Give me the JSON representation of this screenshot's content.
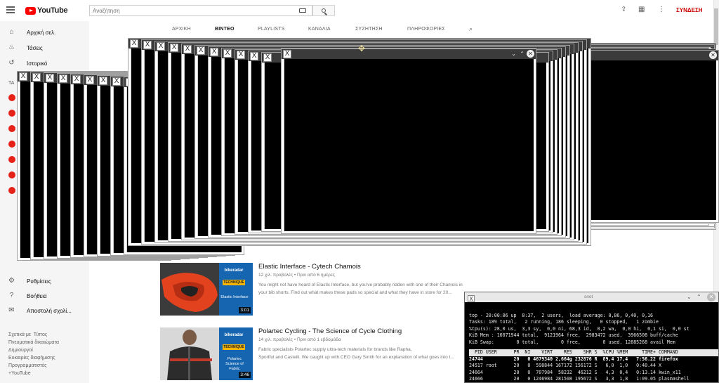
{
  "youtube": {
    "logo_text": "YouTube",
    "search": {
      "placeholder": "Αναζήτηση"
    },
    "signin_label": "ΣΥΝΔΕΣΗ",
    "sidebar": {
      "items": [
        {
          "label": "Αρχική σελ.",
          "icon": "home-icon"
        },
        {
          "label": "Τάσεις",
          "icon": "fire-icon"
        },
        {
          "label": "Ιστορικό",
          "icon": "history-icon"
        }
      ],
      "section_letters": "ΤΑ",
      "bottom_items": [
        {
          "label": "Ρυθμίσεις",
          "icon": "gear-icon"
        },
        {
          "label": "Βοήθεια",
          "icon": "help-icon"
        },
        {
          "label": "Αποστολή σχολί...",
          "icon": "feedback-icon"
        }
      ],
      "footer_links": [
        "Σχετικά με",
        "Τύπος",
        "Πνευματικά δικαιώματα",
        "Δημιουργοί",
        "Ευκαιρίες διαφήμισης",
        "Προγραμματιστές",
        "+YouTube"
      ]
    },
    "channel_tabs": [
      {
        "label": "ΑΡΧΙΚΗ",
        "active": false
      },
      {
        "label": "ΒΙΝΤΕΟ",
        "active": true
      },
      {
        "label": "PLAYLISTS",
        "active": false
      },
      {
        "label": "ΚΑΝΑΛΙΑ",
        "active": false
      },
      {
        "label": "ΣΥΖΗΤΗΣΗ",
        "active": false
      },
      {
        "label": "ΠΛΗΡΟΦΟΡΙΕΣ",
        "active": false
      }
    ],
    "videos": [
      {
        "title": "Elastic Interface - Cytech Chamois",
        "meta": "12 χιλ. προβολές • Πριν από 6 ημέρες",
        "desc_1": "You might not have heard of Elastic Interface, but you've probably ridden with one of their Chamois in",
        "desc_2": "your bib shorts. Find out what makes these pads so special and what they have in store for 20...",
        "badge": "bikeradar",
        "badge_sub": "TECHNIQUE",
        "panel_text": "Elastic Interface",
        "duration": "3:01"
      },
      {
        "title": "Polartec Cycling - The Science of Cycle Clothing",
        "meta": "14 χιλ. προβολές • Πριν από 1 εβδομάδα",
        "desc_1": "Fabric specialists Polartec supply ultra-tech materials for brands like Rapha,",
        "desc_2": "Sportful and Castelli. We caught up with CEO Gary Smith for an explanation of what goes into t...",
        "badge": "bikeradar",
        "badge_sub": "TECHNIQUE",
        "panel_text": "Polartec Science of Fabric",
        "duration": "3:46"
      }
    ]
  },
  "xwindow": {
    "title_glyph": "X",
    "close_glyph": "✕",
    "min_glyph": "⌄",
    "max_glyph": "⌃"
  },
  "terminal": {
    "title": "snot",
    "lines": {
      "l1": "top - 20:00:06 up  8:37,  2 users,  load average: 0,86, 0,40, 0,16",
      "l2": "Tasks: 189 total,   2 running, 186 sleeping,   0 stopped,   1 zombie",
      "l3": "%Cpu(s): 28,0 us,  3,3 sy,  0,0 ni, 68,3 id,  0,2 wa,  0,0 hi,  0,1 si,  0,0 st",
      "l4": "KiB Mem : 16071944 total,  9121964 free,  2983472 used,  3966508 buff/cache",
      "l5": "KiB Swap:        0 total,        0 free,        0 used. 12885268 avail Mem",
      "header": "  PID USER      PR  NI    VIRT    RES    SHR S  %CPU %MEM     TIME+ COMMAND",
      "p1": "24744           20   0 4679340 2,664g 232876 R  89,4 17,4   7:56.22 firefox",
      "p2": "24517 root      20   0  598844 167172 156172 S   6,0  1,0   0:40.44 X",
      "p3": "24664           20   0  707984  58232  46212 S   4,3  0,4   0:13.14 kwin_x11",
      "p4": "24666           20   0 1246984 281508 195672 S   3,3  1,8   1:09.05 plasmashell"
    }
  }
}
